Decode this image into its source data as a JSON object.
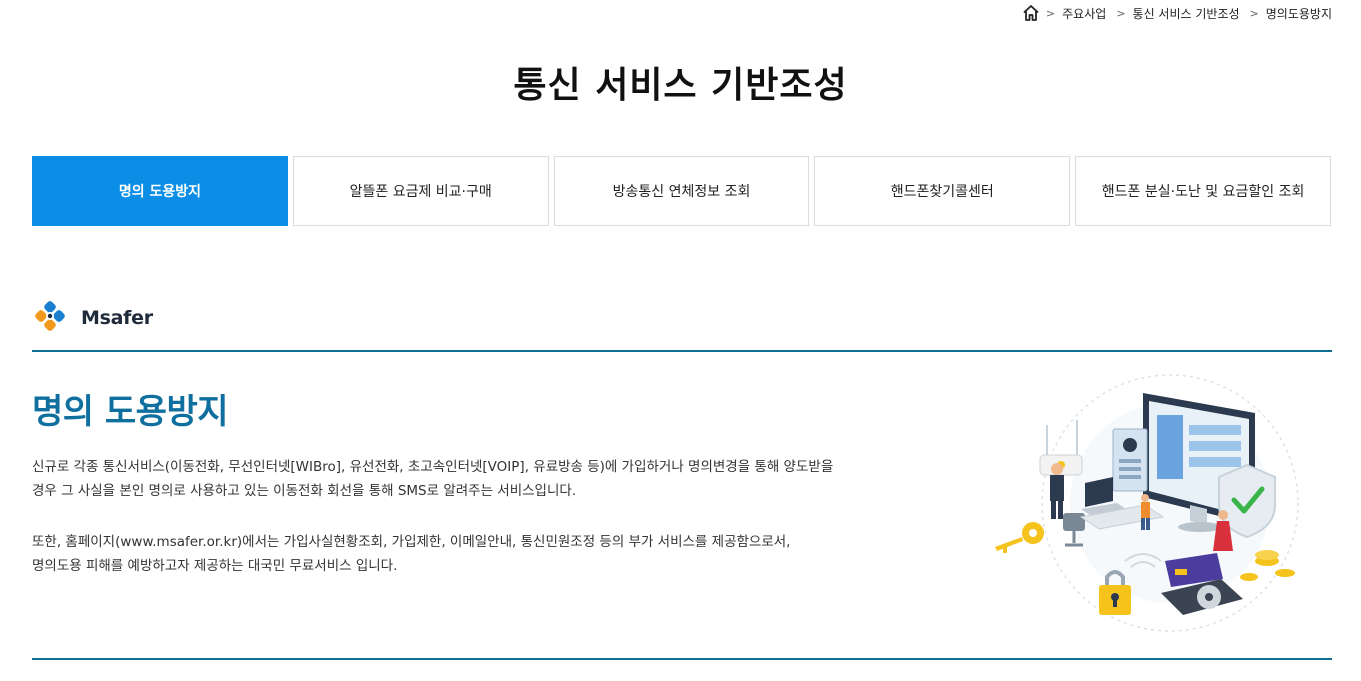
{
  "breadcrumb": {
    "items": [
      "주요사업",
      "통신 서비스 기반조성",
      "명의도용방지"
    ]
  },
  "page_title": "통신 서비스 기반조성",
  "tabs": [
    {
      "label": "명의 도용방지",
      "active": true
    },
    {
      "label": "알뜰폰 요금제 비교·구매",
      "active": false
    },
    {
      "label": "방송통신 연체정보 조회",
      "active": false
    },
    {
      "label": "핸드폰찾기콜센터",
      "active": false
    },
    {
      "label": "핸드폰 분실·도난 및 요금할인 조회",
      "active": false
    }
  ],
  "logo": {
    "text": "Msafer",
    "icon": "msafer-logo-icon"
  },
  "section": {
    "title": "명의 도용방지",
    "paragraph1_line1": "신규로 각종 통신서비스(이동전화, 무선인터넷[WIBro], 유선전화, 초고속인터넷[VOIP], 유료방송 등)에 가입하거나 명의변경을 통해 양도받을",
    "paragraph1_line2": "경우 그 사실을 본인 명의로 사용하고 있는 이동전화 회선을 통해 SMS로 알려주는 서비스입니다.",
    "paragraph2_line1": "또한, 홈페이지(www.msafer.or.kr)에서는 가입사실현황조회, 가입제한, 이메일안내, 통신민원조정 등의 부가 서비스를 제공함으로서,",
    "paragraph2_line2": "명의도용 피해를 예방하고자 제공하는 대국민 무료서비스 입니다."
  },
  "colors": {
    "accent": "#0d8ee6",
    "title_blue": "#0f6f9e",
    "rule": "#0f6f92"
  }
}
